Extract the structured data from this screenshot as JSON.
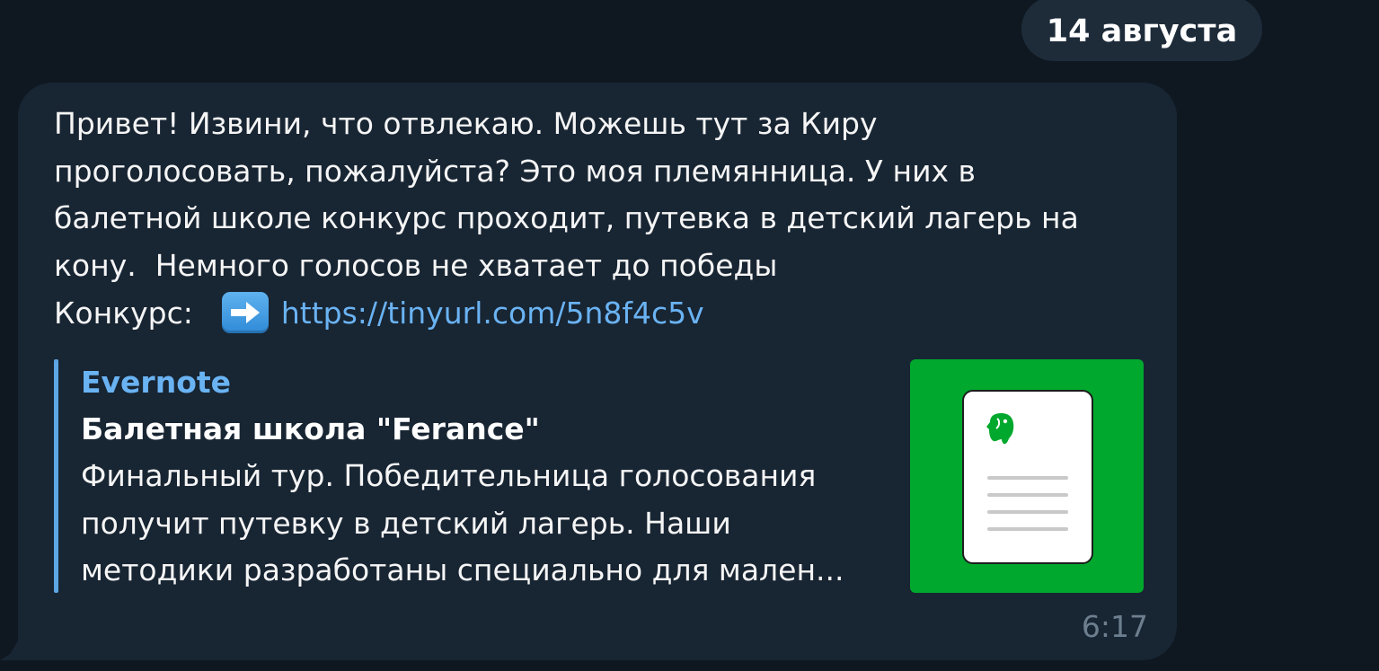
{
  "date_separator": "14 августа",
  "message": {
    "text": "Привет! Извини, что отвлекаю. Можешь тут за Киру\nпроголосовать, пожалуйста? Это моя племянница. У них в\nбалетной школе конкурс проходит, путевка в детский лагерь на\nкону.  Немного голосов не хватает до победы",
    "link_label": "Конкурс:",
    "link_emoji": "right-arrow-emoji",
    "link_url": "https://tinyurl.com/5n8f4c5v",
    "time": "6:17"
  },
  "link_preview": {
    "site_name": "Evernote",
    "title": "Балетная школа \"Ferance\"",
    "description": "Финальный тур. Победительница голосования\nполучит путевку в детский лагерь. Наши\nметодики разработаны специально для мален...",
    "thumbnail_icon": "evernote-document-icon"
  },
  "colors": {
    "background": "#0f1821",
    "bubble": "#182533",
    "link": "#6ab3f3",
    "preview_bar": "#5da6e3",
    "thumbnail": "#00a82d",
    "time": "#6d7f8f"
  }
}
